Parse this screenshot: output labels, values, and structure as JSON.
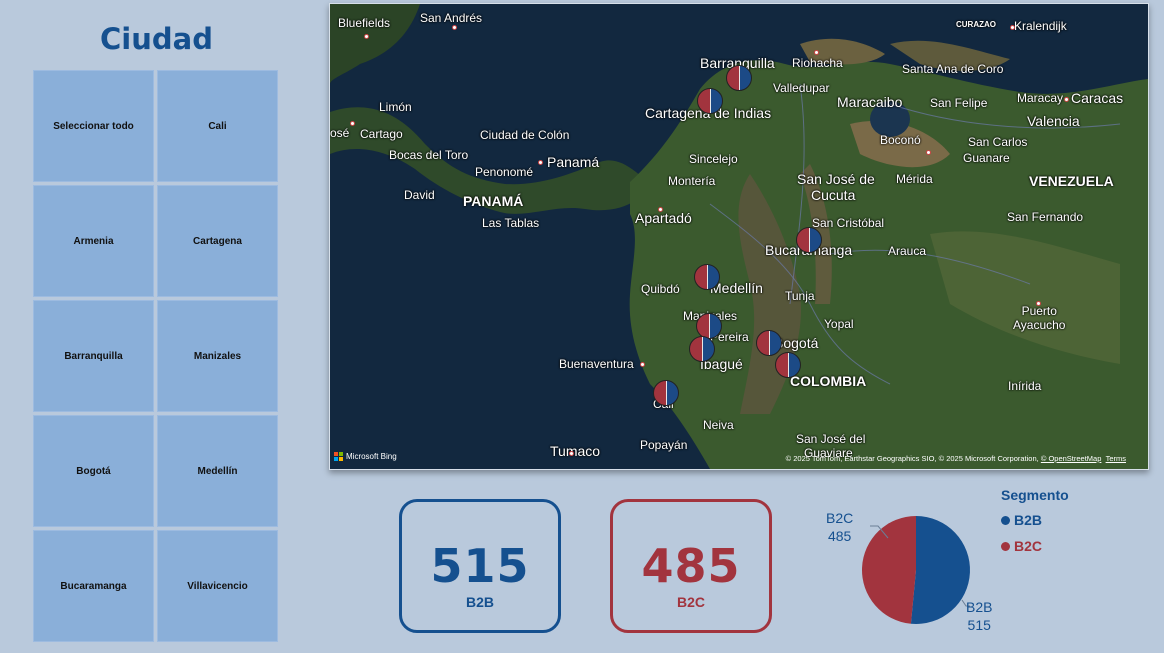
{
  "slicer": {
    "title": "Ciudad",
    "items": [
      {
        "label": "Seleccionar todo"
      },
      {
        "label": "Cali"
      },
      {
        "label": "Armenia"
      },
      {
        "label": "Cartagena"
      },
      {
        "label": "Barranquilla"
      },
      {
        "label": "Manizales"
      },
      {
        "label": "Bogotá"
      },
      {
        "label": "Medellín"
      },
      {
        "label": "Bucaramanga"
      },
      {
        "label": "Villavicencio"
      }
    ]
  },
  "map": {
    "labels": {
      "bluefields": "Bluefields",
      "sanandres": "San Andrés",
      "curazao": "CURAZAO",
      "kralendijk": "Kralendijk",
      "barranquilla": "Barranquilla",
      "riohacha": "Riohacha",
      "santaana": "Santa Ana de Coro",
      "valledupar": "Valledupar",
      "maracaibo": "Maracaibo",
      "sanfelipe": "San Felipe",
      "maracay": "Maracay",
      "caracas": "Caracas",
      "valencia": "Valencia",
      "cartagena": "Cartagena de Indias",
      "limon": "Limón",
      "jose": "osé",
      "cartago": "Cartago",
      "ciudadcolon": "Ciudad de Colón",
      "panama": "Panamá",
      "bocas": "Bocas del Toro",
      "penonome": "Penonomé",
      "david": "David",
      "panamaCountry": "PANAMÁ",
      "lastablas": "Las Tablas",
      "sincelejo": "Sincelejo",
      "monteria": "Montería",
      "bocono": "Boconó",
      "sancarlos": "San Carlos",
      "guanare": "Guanare",
      "sanjose": "San José de",
      "cucuta": "Cucuta",
      "merida": "Mérida",
      "venezuela": "VENEZUELA",
      "apartado": "Apartadó",
      "sancristobal": "San Cristóbal",
      "sanfernando": "San Fernando",
      "bucaramanga": "Bucaramanga",
      "arauca": "Arauca",
      "quibdo": "Quibdó",
      "medellin": "Medellín",
      "tunja": "Tunja",
      "puertoayacucho": "Puerto\nAyacucho",
      "manizales": "Manizales",
      "yopal": "Yopal",
      "pereira": "Pereira",
      "bogota": "Bogotá",
      "buenaventura": "Buenaventura",
      "ibague": "Ibagué",
      "colombia": "COLOMBIA",
      "inirida": "Inírida",
      "cali": "Cali",
      "neiva": "Neiva",
      "popayan": "Popayán",
      "tumaco": "Tumaco",
      "sanjoseguaviare": "San José del",
      "guaviare": "Guaviare"
    },
    "bing": "Microsoft Bing",
    "copyright": "© 2025 TomTom, Earthstar Geographics SIO, © 2025 Microsoft Corporation,",
    "osm": "© OpenStreetMap",
    "terms": "Terms",
    "pie_cities": [
      "Barranquilla",
      "Cartagena",
      "Medellín",
      "Bucaramanga",
      "Manizales",
      "Pereira",
      "Bogotá",
      "Villavicencio",
      "Cali"
    ]
  },
  "cards": {
    "b2b": {
      "value": "515",
      "label": "B2B"
    },
    "b2c": {
      "value": "485",
      "label": "B2C"
    }
  },
  "chart_data": {
    "type": "pie",
    "title": "",
    "legend_title": "Segmento",
    "categories": [
      "B2B",
      "B2C"
    ],
    "values": [
      515,
      485
    ],
    "colors": [
      "#15508f",
      "#a2343e"
    ],
    "legend_position": "top-right"
  }
}
